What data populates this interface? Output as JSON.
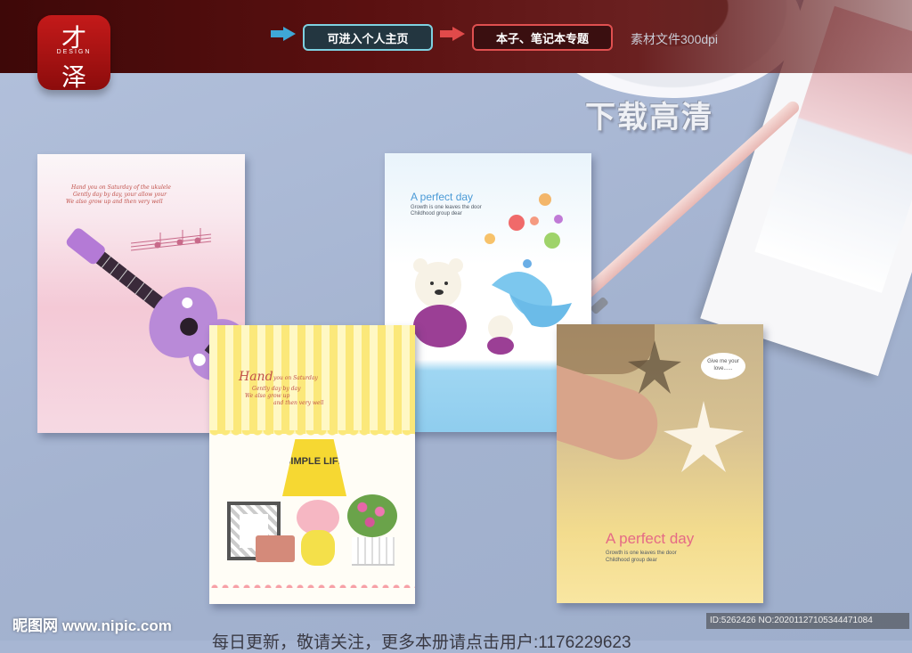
{
  "header": {
    "logo": {
      "char_top": "才",
      "brand": "DESIGN",
      "char_bottom": "泽"
    },
    "nav_home": "可进入个人主页",
    "nav_topic": "本子、笔记本专题",
    "spec": "素材文件300dpi",
    "download": "下载高清"
  },
  "books": [
    {
      "lines": [
        "Hand you on Saturday of the ukulele",
        "Gently day by day, your allow your",
        "We also grow up  and then very well"
      ]
    },
    {
      "title": "A perfect day",
      "sub1": "Growth is one leaves the door",
      "sub2": "Childhood group dear"
    },
    {
      "title_word": "Hand",
      "lines": [
        "you on Saturday",
        "Gently day by day",
        "We also grow up",
        "and then very well"
      ],
      "lamp_text": "SIMPLE LIFE"
    },
    {
      "bubble": "Give me your love......",
      "title": "A perfect day",
      "sub1": "Growth is one leaves the door",
      "sub2": "Childhood group dear"
    }
  ],
  "footer": {
    "watermark": "昵图网 www.nipic.com",
    "id_text": "ID:5262426 NO:20201127105344471084",
    "daily": "每日更新，敬请关注，更多本册请点击用户:1176229623"
  },
  "colors": {
    "accent_teal": "#7fd1e0",
    "accent_red": "#e05050",
    "title_blue": "#4a9ad6",
    "title_pink": "#e56a86"
  }
}
